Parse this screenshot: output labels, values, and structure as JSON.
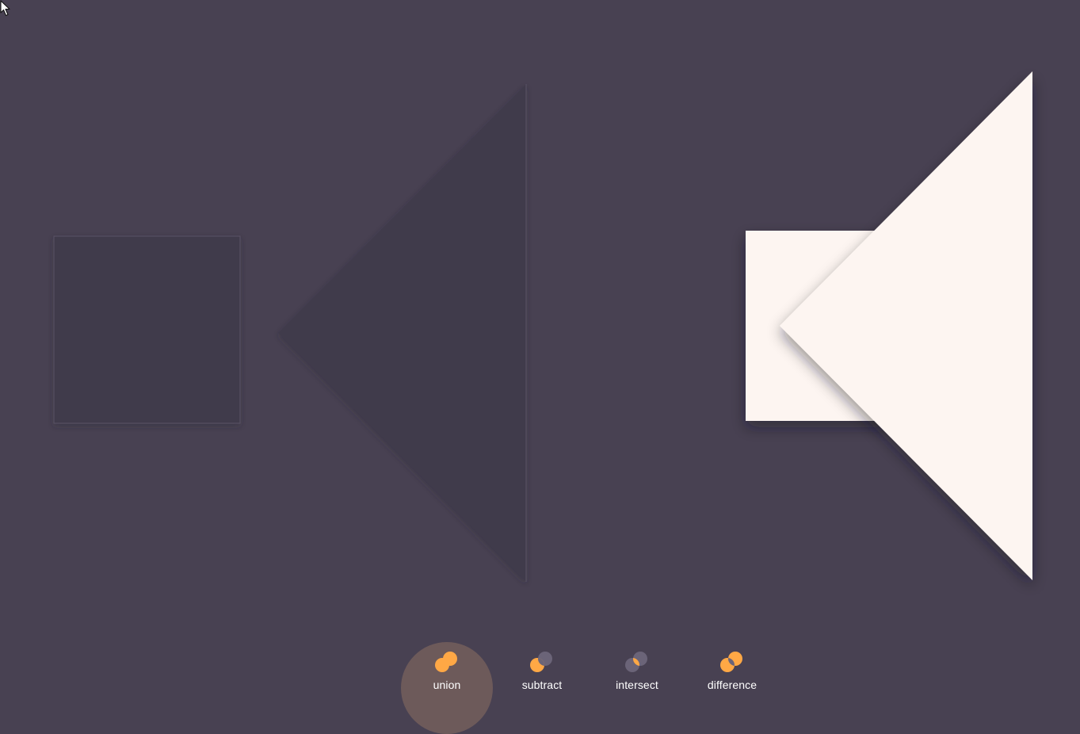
{
  "canvas": {
    "background_color": "#484152",
    "source_shape_color": "#3f3a4b",
    "result_shape_color": "#fdf5f1"
  },
  "toolbar": {
    "active_operation": "union",
    "accent_color": "#ffa845",
    "inactive_circle_color": "#6b6478",
    "active_highlight_color": "#6d5a5a",
    "operations": [
      {
        "id": "union",
        "label": "union",
        "icon": "union-icon"
      },
      {
        "id": "subtract",
        "label": "subtract",
        "icon": "subtract-icon"
      },
      {
        "id": "intersect",
        "label": "intersect",
        "icon": "intersect-icon"
      },
      {
        "id": "difference",
        "label": "difference",
        "icon": "difference-icon"
      }
    ]
  }
}
